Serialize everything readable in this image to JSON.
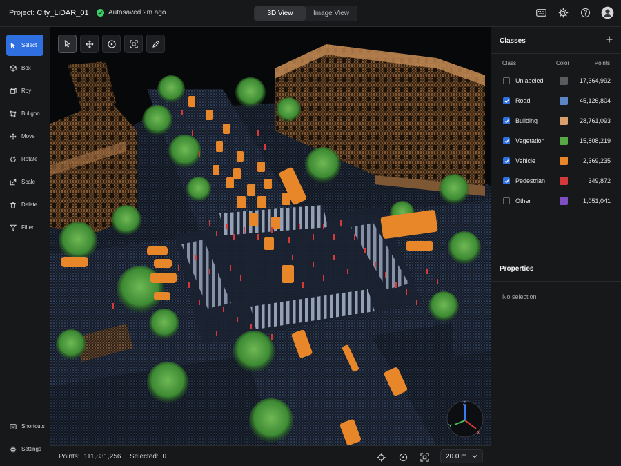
{
  "topbar": {
    "project_label": "Project:",
    "project_name": "City_LiDAR_01",
    "autosave": "Autosaved 2m ago",
    "view_tabs": [
      "3D View",
      "Image View"
    ],
    "active_view": "3D View",
    "icons": [
      "keyboard-icon",
      "gear-icon",
      "help-icon",
      "avatar-icon"
    ]
  },
  "tools": [
    {
      "label": "Select",
      "icon": "cursor-icon",
      "active": true
    },
    {
      "label": "Box",
      "icon": "cube-icon"
    },
    {
      "label": "Roy",
      "icon": "cube-outline-icon"
    },
    {
      "label": "Bullgon",
      "icon": "polygon-icon"
    },
    {
      "label": "Move",
      "icon": "move-icon"
    },
    {
      "label": "Rotate",
      "icon": "rotate-icon"
    },
    {
      "label": "Scale",
      "icon": "scale-icon"
    },
    {
      "label": "Delete",
      "icon": "trash-icon"
    },
    {
      "label": "Filter",
      "icon": "filter-icon"
    }
  ],
  "bottom_tools": [
    {
      "label": "Shortcuts",
      "icon": "keyboard-icon"
    },
    {
      "label": "Settings",
      "icon": "gear-icon"
    }
  ],
  "viewport_tools": [
    "pointer-icon",
    "move-icon",
    "orbit-icon",
    "frame-icon",
    "pencil-icon"
  ],
  "axes": {
    "x": "X",
    "y": "Y",
    "z": "Z"
  },
  "status": {
    "points_label": "Points:",
    "points_value": "111,831,256",
    "selected_label": "Selected:",
    "selected_value": "0",
    "zoom": "20.0 m"
  },
  "classes_panel": {
    "title": "Classes",
    "columns": [
      "Class",
      "Color",
      "Points"
    ],
    "rows": [
      {
        "name": "Unlabeled",
        "checked": false,
        "color": "#5a5b5f",
        "points": "17,364,992"
      },
      {
        "name": "Road",
        "checked": true,
        "color": "#5b86c6",
        "points": "45,126,804"
      },
      {
        "name": "Building",
        "checked": true,
        "color": "#d9a06d",
        "points": "28,761,093"
      },
      {
        "name": "Vegetation",
        "checked": true,
        "color": "#58a845",
        "points": "15,808,219"
      },
      {
        "name": "Vehicle",
        "checked": true,
        "color": "#e8872a",
        "points": "2,369,235"
      },
      {
        "name": "Pedestrian",
        "checked": true,
        "color": "#d6393a",
        "points": "349,872"
      },
      {
        "name": "Other",
        "checked": false,
        "color": "#7d4fc2",
        "points": "1,051,041"
      }
    ]
  },
  "properties_panel": {
    "title": "Properties",
    "empty": "No selection"
  }
}
